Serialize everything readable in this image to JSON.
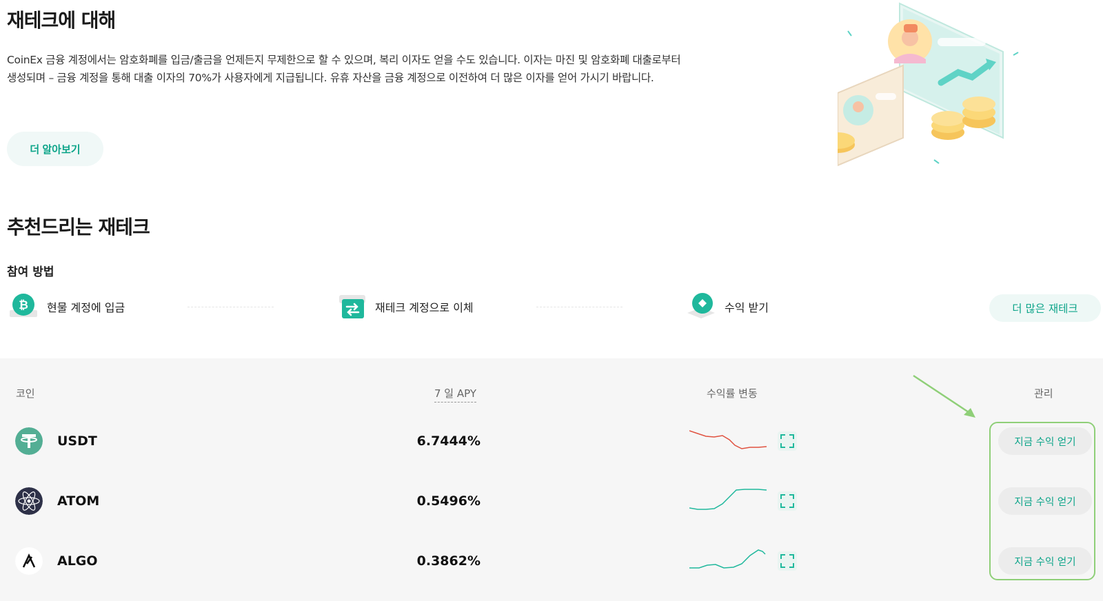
{
  "about": {
    "title": "재테크에 대해",
    "description": "CoinEx 금융 계정에서는 암호화폐를 입금/출금을 언제든지 무제한으로 할 수 있으며, 복리 이자도 얻을 수도 있습니다. 이자는 마진 및 암호화폐 대출로부터 생성되며 – 금융 계정을 통해 대출 이자의 70%가 사용자에게 지급됩니다. 유휴 자산을 금융 계정으로 이전하여 더 많은 이자를 얻어 가시기 바랍니다.",
    "learn_more_label": "더 알아보기"
  },
  "recommend": {
    "title": "추천드리는 재테크",
    "how_label": "참여 방법",
    "steps": [
      {
        "label": "현물 계정에 입금",
        "icon": "bitcoin-deposit-icon"
      },
      {
        "label": "재테크 계정으로 이체",
        "icon": "transfer-icon"
      },
      {
        "label": "수익 받기",
        "icon": "earn-icon"
      }
    ],
    "more_label": "더 많은 재테크"
  },
  "table": {
    "headers": {
      "coin": "코인",
      "apy": "7 일 APY",
      "trend": "수익률 변동",
      "manage": "관리"
    },
    "rows": [
      {
        "coin": "USDT",
        "apy": "6.7444%",
        "earn_label": "지금 수익 얻기",
        "trend": "down",
        "trend_color": "#e0513f"
      },
      {
        "coin": "ATOM",
        "apy": "0.5496%",
        "earn_label": "지금 수익 얻기",
        "trend": "up",
        "trend_color": "#1fb89c"
      },
      {
        "coin": "ALGO",
        "apy": "0.3862%",
        "earn_label": "지금 수익 얻기",
        "trend": "up",
        "trend_color": "#1fb89c"
      }
    ]
  },
  "colors": {
    "accent": "#0ea58a",
    "highlight": "#8fcf78"
  }
}
